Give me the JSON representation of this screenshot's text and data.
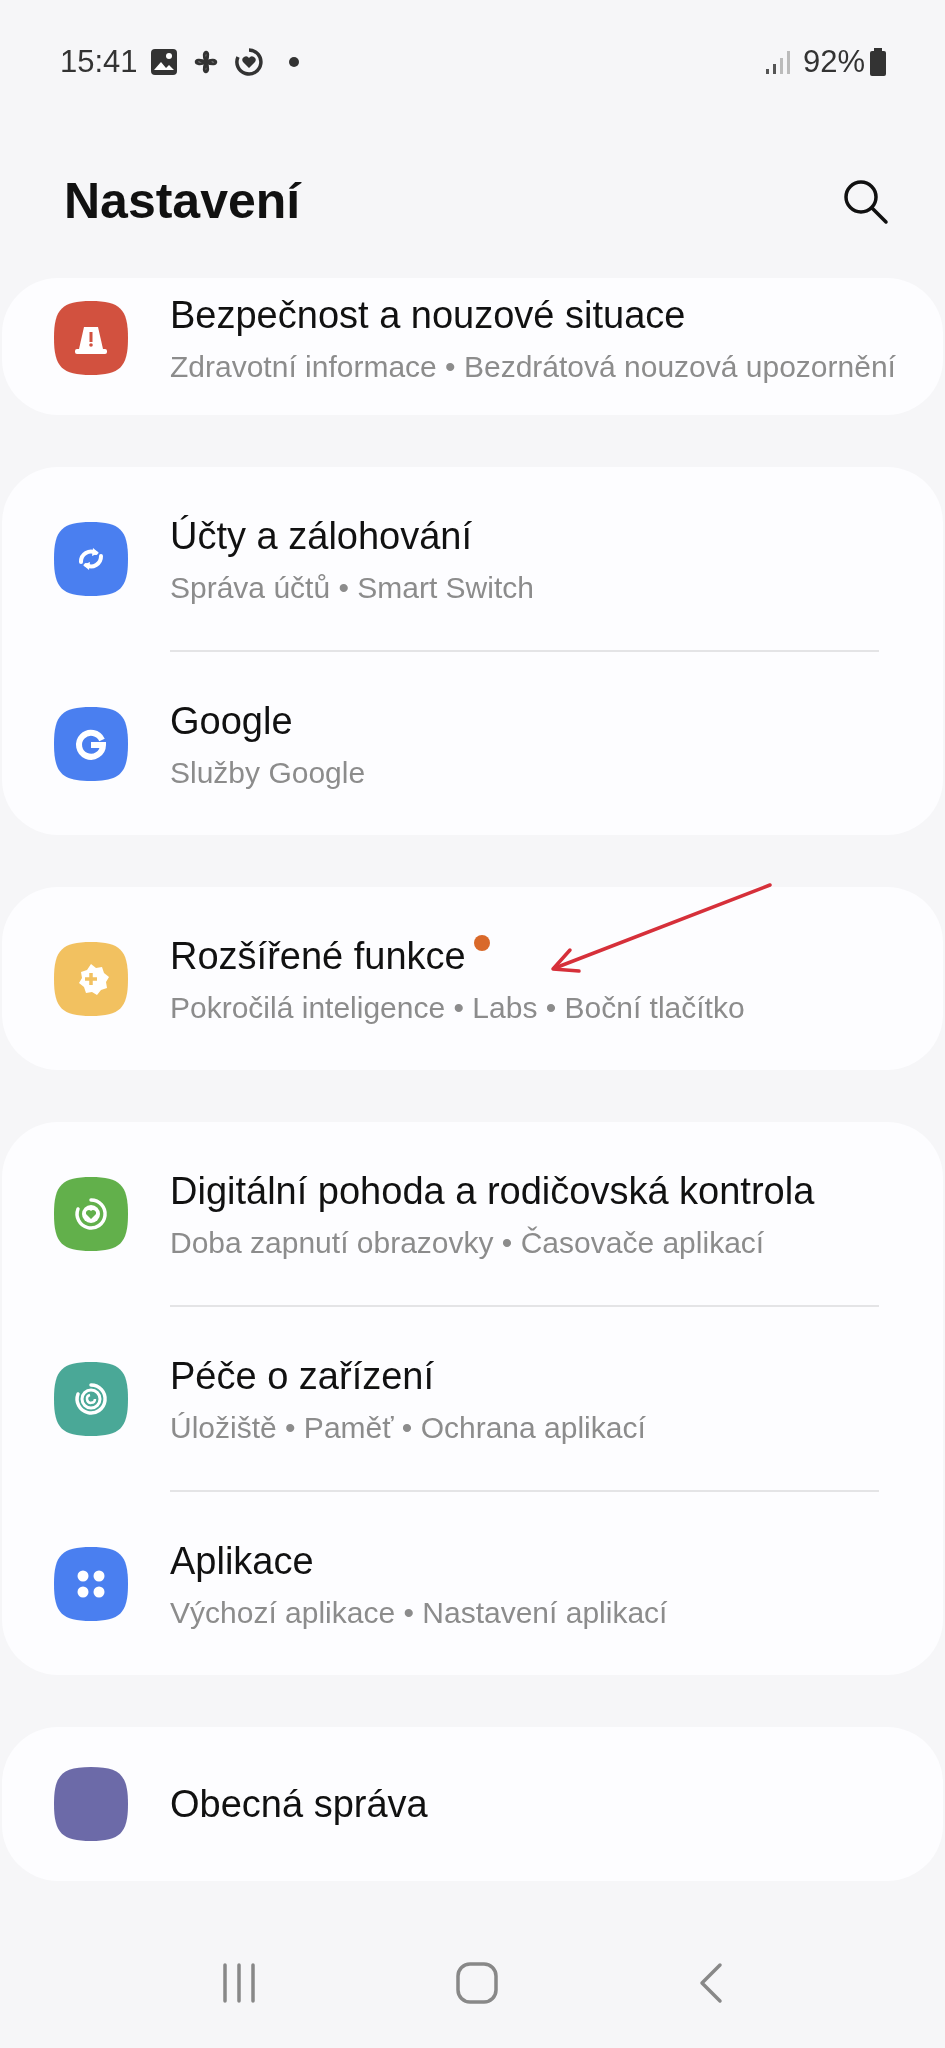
{
  "status_bar": {
    "time": "15:41",
    "battery": "92%"
  },
  "header": {
    "title": "Nastavení"
  },
  "cards": [
    {
      "items": [
        {
          "title": "Bezpečnost a nouzové situace",
          "subtitle": "Zdravotní informace • Bezdrátová nouzová upozornění",
          "badge": false
        }
      ]
    },
    {
      "items": [
        {
          "title": "Účty a zálohování",
          "subtitle": "Správa účtů • Smart Switch",
          "badge": false
        },
        {
          "title": "Google",
          "subtitle": "Služby Google",
          "badge": false
        }
      ]
    },
    {
      "items": [
        {
          "title": "Rozšířené funkce",
          "subtitle": "Pokročilá inteligence • Labs • Boční tlačítko",
          "badge": true
        }
      ]
    },
    {
      "items": [
        {
          "title": "Digitální pohoda a rodičovská kontrola",
          "subtitle": "Doba zapnutí obrazovky • Časovače aplikací",
          "badge": false
        },
        {
          "title": "Péče o zařízení",
          "subtitle": "Úložiště • Paměť • Ochrana aplikací",
          "badge": false
        },
        {
          "title": "Aplikace",
          "subtitle": "Výchozí aplikace • Nastavení aplikací",
          "badge": false
        }
      ]
    },
    {
      "items": [
        {
          "title": "Obecná správa",
          "badge": false
        }
      ]
    }
  ],
  "annotation": {
    "kind": "arrow"
  }
}
